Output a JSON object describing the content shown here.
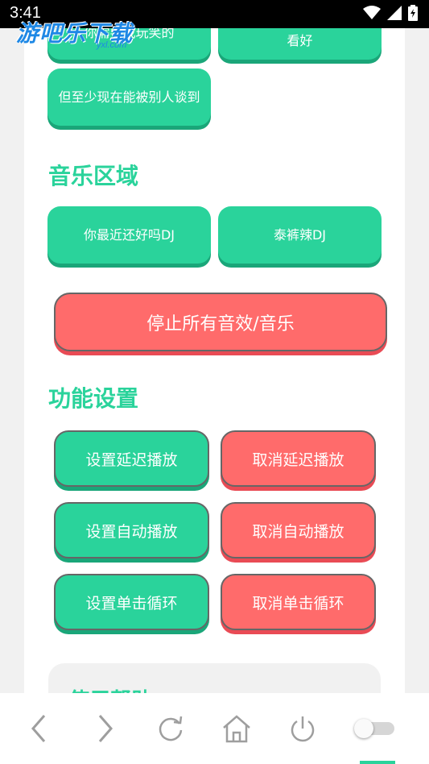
{
  "status_bar": {
    "time": "3:41"
  },
  "watermark": {
    "logo_text": "游吧乐下载",
    "logo_domain": "yxl.com"
  },
  "sound_buttons_partial": [
    {
      "label": "你需要我玩笑的"
    },
    {
      "label": "看好"
    },
    {
      "label": "但至少现在能被别人谈到"
    }
  ],
  "music_section": {
    "title": "音乐区域",
    "buttons": [
      {
        "label": "你最近还好吗DJ"
      },
      {
        "label": "泰裤辣DJ"
      }
    ],
    "stop_all_label": "停止所有音效/音乐"
  },
  "settings_section": {
    "title": "功能设置",
    "buttons": [
      {
        "label": "设置延迟播放",
        "color": "#2ad39b"
      },
      {
        "label": "取消延迟播放",
        "color": "#ff6b6b"
      },
      {
        "label": "设置自动播放",
        "color": "#2ad39b"
      },
      {
        "label": "取消自动播放",
        "color": "#ff6b6b"
      },
      {
        "label": "设置单击循环",
        "color": "#2ad39b"
      },
      {
        "label": "取消单击循环",
        "color": "#ff6b6b"
      }
    ]
  },
  "help_card": {
    "title": "使用帮助"
  },
  "bottom_nav": {
    "icons": [
      "back-icon",
      "forward-icon",
      "refresh-icon",
      "home-icon",
      "power-icon"
    ],
    "toggle_state": "off"
  },
  "colors": {
    "accent_green": "#2ad39b",
    "accent_red": "#ff6b6b"
  }
}
